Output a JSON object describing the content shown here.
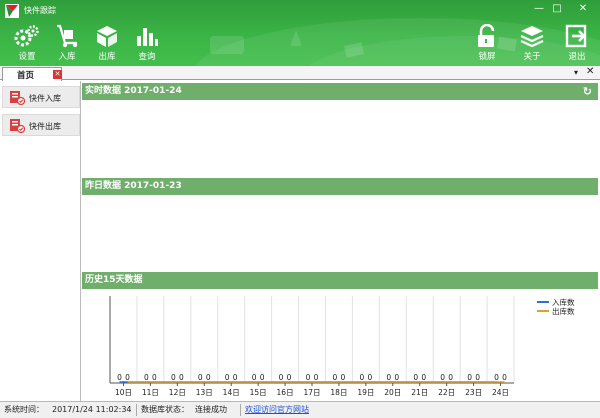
{
  "window": {
    "title": "快件跟踪",
    "min_glyph": "—",
    "max_glyph": "□",
    "close_glyph": "✕"
  },
  "toolbar": {
    "settings": "设置",
    "inbound": "入库",
    "outbound": "出库",
    "query": "查询",
    "lock": "锁屏",
    "about": "关于",
    "exit": "退出"
  },
  "tabs": [
    {
      "label": "首页",
      "close_glyph": "✕"
    }
  ],
  "tabbar": {
    "menu_glyph": "▾",
    "close_glyph": "✕"
  },
  "sidebar": {
    "items": [
      {
        "label": "快件入库",
        "icon": "parcel-in-icon"
      },
      {
        "label": "快件出库",
        "icon": "parcel-out-icon"
      }
    ]
  },
  "panels": {
    "realtime": {
      "title": "实时数据  2017-01-24",
      "refresh_glyph": "↻"
    },
    "yesterday": {
      "title": "昨日数据  2017-01-23"
    },
    "history": {
      "title": "历史15天数据"
    }
  },
  "colors": {
    "inbound_line": "#2e6fdc",
    "outbound_line": "#e0a030",
    "panel_head": "#6fae6b",
    "header": "#3bb446"
  },
  "chart_data": {
    "type": "line",
    "categories": [
      "10日",
      "11日",
      "12日",
      "13日",
      "14日",
      "15日",
      "16日",
      "17日",
      "18日",
      "19日",
      "20日",
      "21日",
      "22日",
      "23日",
      "24日"
    ],
    "series": [
      {
        "name": "入库数",
        "values": [
          0,
          0,
          0,
          0,
          0,
          0,
          0,
          0,
          0,
          0,
          0,
          0,
          0,
          0,
          0
        ]
      },
      {
        "name": "出库数",
        "values": [
          0,
          0,
          0,
          0,
          0,
          0,
          0,
          0,
          0,
          0,
          0,
          0,
          0,
          0,
          0
        ]
      }
    ],
    "ylim": [
      0,
      1
    ],
    "grid": true,
    "legend": "top-right"
  },
  "status": {
    "time_label": "系统时间：",
    "time_value": "2017/1/24 11:02:34",
    "db_label": "数据库状态：",
    "db_value": "连接成功",
    "link": "欢迎访问官方网站"
  }
}
